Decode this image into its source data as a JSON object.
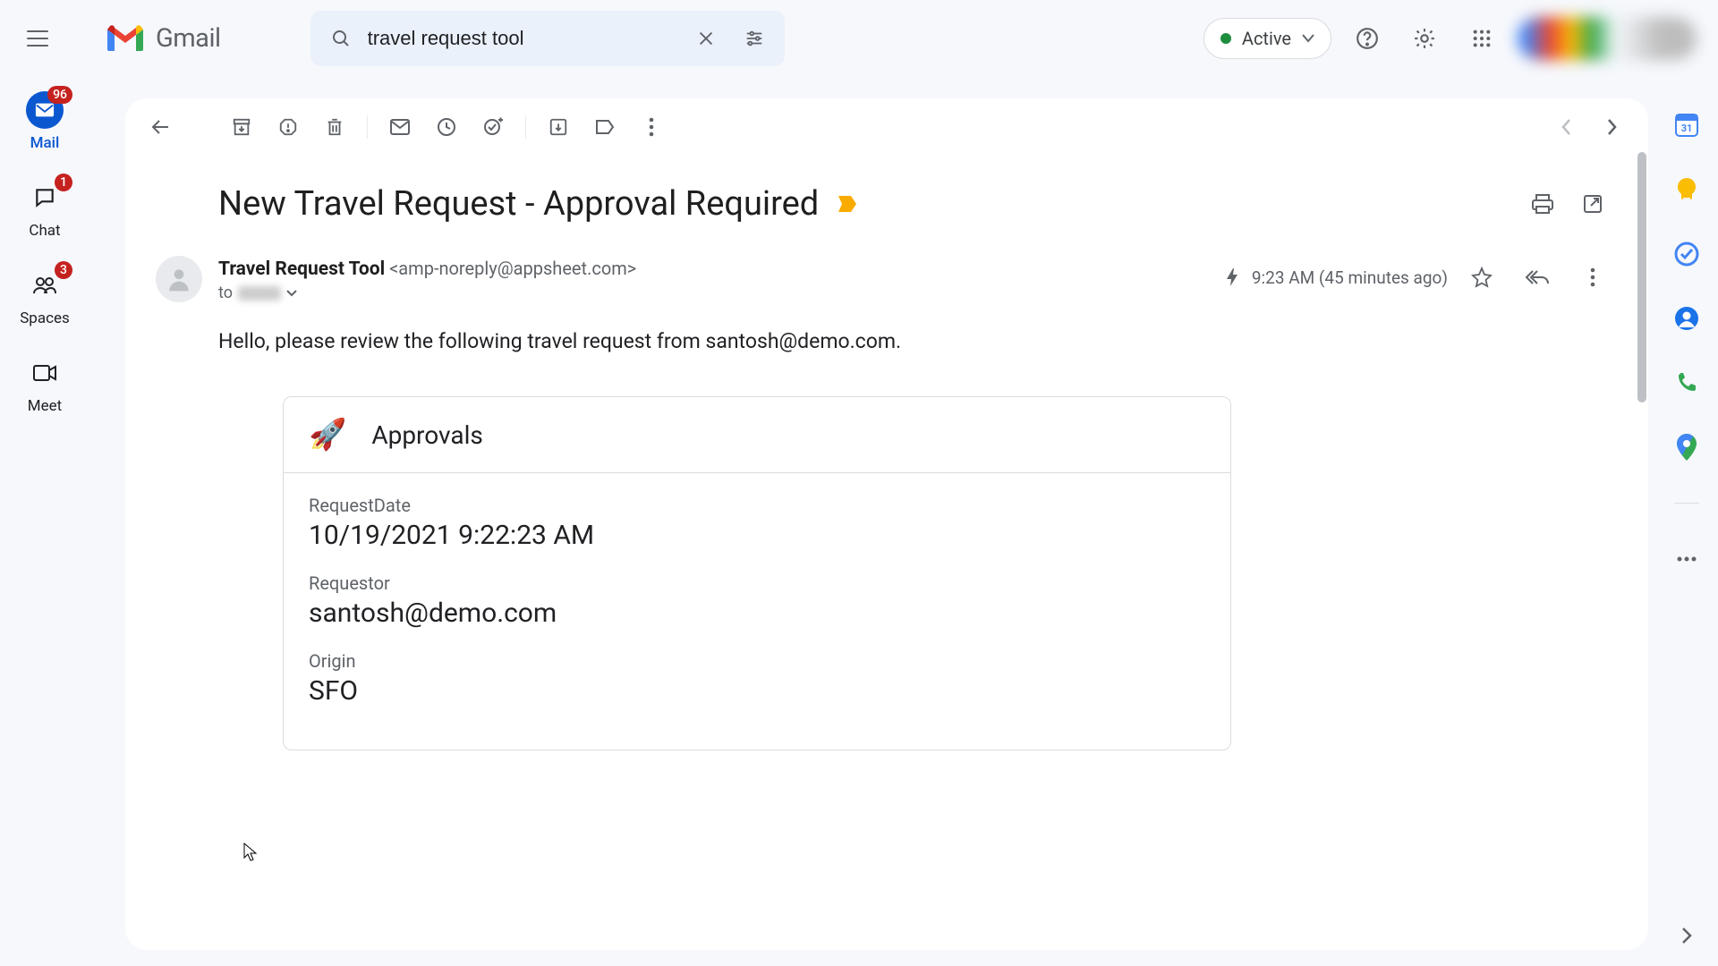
{
  "header": {
    "app_name": "Gmail",
    "search_value": "travel request tool",
    "status_label": "Active"
  },
  "nav": {
    "items": [
      {
        "label": "Mail",
        "badge": "96",
        "selected": true
      },
      {
        "label": "Chat",
        "badge": "1",
        "selected": false
      },
      {
        "label": "Spaces",
        "badge": "3",
        "selected": false
      },
      {
        "label": "Meet",
        "badge": "",
        "selected": false
      }
    ]
  },
  "message": {
    "subject": "New Travel Request - Approval Required",
    "sender_name": "Travel Request Tool",
    "sender_email": "<amp-noreply@appsheet.com>",
    "to_label": "to",
    "timestamp": "9:23 AM (45 minutes ago)",
    "greeting": "Hello, please review the following travel request from santosh@demo.com.",
    "card": {
      "title": "Approvals",
      "fields": [
        {
          "label": "RequestDate",
          "value": "10/19/2021 9:22:23 AM"
        },
        {
          "label": "Requestor",
          "value": "santosh@demo.com"
        },
        {
          "label": "Origin",
          "value": "SFO"
        }
      ]
    }
  },
  "side_panel_calendar_day": "31"
}
